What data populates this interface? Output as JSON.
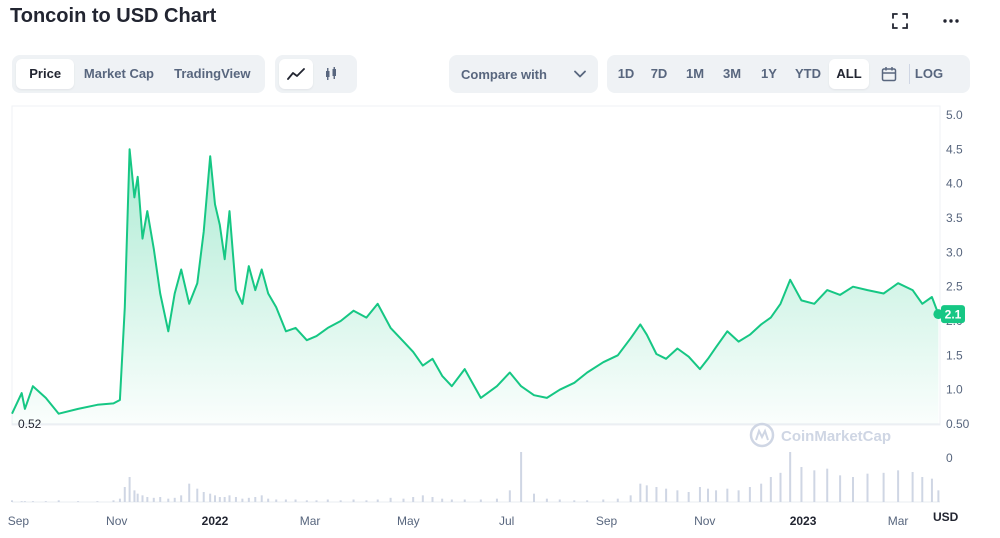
{
  "title": "Toncoin to USD Chart",
  "view_tabs": [
    {
      "label": "Price",
      "active": true
    },
    {
      "label": "Market Cap",
      "active": false
    },
    {
      "label": "TradingView",
      "active": false
    }
  ],
  "chart_type_icons": [
    "line-chart-icon",
    "candlestick-icon"
  ],
  "compare_label": "Compare with",
  "ranges": [
    "1D",
    "7D",
    "1M",
    "3M",
    "1Y",
    "YTD",
    "ALL"
  ],
  "active_range": "ALL",
  "log_label": "LOG",
  "watermark": "CoinMarketCap",
  "colors": {
    "line": "#16c784",
    "fill_top": "#16c784",
    "accent": "#16c784",
    "axis_text": "#58667e",
    "grid": "#eff2f5"
  },
  "chart_data": {
    "type": "area",
    "y_ticks": [
      "5.0",
      "4.5",
      "4.0",
      "3.5",
      "3.0",
      "2.5",
      "2.0",
      "1.5",
      "1.0",
      "0.50"
    ],
    "ylim": [
      0.5,
      5.0
    ],
    "volume_tick": "0",
    "x_ticks": [
      "Sep",
      "Nov",
      "2022",
      "Mar",
      "May",
      "Jul",
      "Sep",
      "Nov",
      "2023",
      "Mar"
    ],
    "x_tick_bold": [
      "2022",
      "2023"
    ],
    "currency_label": "USD",
    "start_label": "0.52",
    "current_value_label": "2.1",
    "x": [
      "2021-08-28",
      "2021-09-03",
      "2021-09-05",
      "2021-09-10",
      "2021-09-18",
      "2021-09-26",
      "2021-10-08",
      "2021-10-20",
      "2021-10-30",
      "2021-11-03",
      "2021-11-06",
      "2021-11-09",
      "2021-11-12",
      "2021-11-14",
      "2021-11-17",
      "2021-11-20",
      "2021-11-24",
      "2021-11-28",
      "2021-12-03",
      "2021-12-07",
      "2021-12-11",
      "2021-12-16",
      "2021-12-21",
      "2021-12-25",
      "2021-12-29",
      "2022-01-01",
      "2022-01-04",
      "2022-01-07",
      "2022-01-10",
      "2022-01-14",
      "2022-01-18",
      "2022-01-22",
      "2022-01-26",
      "2022-01-30",
      "2022-02-03",
      "2022-02-08",
      "2022-02-14",
      "2022-02-20",
      "2022-02-27",
      "2022-03-05",
      "2022-03-12",
      "2022-03-20",
      "2022-03-28",
      "2022-04-05",
      "2022-04-12",
      "2022-04-20",
      "2022-04-28",
      "2022-05-04",
      "2022-05-10",
      "2022-05-16",
      "2022-05-22",
      "2022-05-28",
      "2022-06-05",
      "2022-06-15",
      "2022-06-25",
      "2022-07-03",
      "2022-07-10",
      "2022-07-18",
      "2022-07-26",
      "2022-08-03",
      "2022-08-12",
      "2022-08-20",
      "2022-08-30",
      "2022-09-08",
      "2022-09-16",
      "2022-09-22",
      "2022-09-26",
      "2022-10-02",
      "2022-10-08",
      "2022-10-15",
      "2022-10-22",
      "2022-10-29",
      "2022-11-03",
      "2022-11-08",
      "2022-11-15",
      "2022-11-22",
      "2022-11-29",
      "2022-12-06",
      "2022-12-12",
      "2022-12-18",
      "2022-12-24",
      "2022-12-31",
      "2023-01-08",
      "2023-01-16",
      "2023-01-24",
      "2023-02-01",
      "2023-02-10",
      "2023-02-20",
      "2023-03-01",
      "2023-03-10",
      "2023-03-16",
      "2023-03-22",
      "2023-03-26"
    ],
    "values": [
      0.65,
      0.95,
      0.72,
      1.05,
      0.88,
      0.65,
      0.72,
      0.78,
      0.8,
      0.85,
      2.2,
      4.5,
      3.8,
      4.1,
      3.2,
      3.6,
      3.05,
      2.4,
      1.85,
      2.4,
      2.75,
      2.25,
      2.55,
      3.3,
      4.4,
      3.7,
      3.4,
      2.9,
      3.6,
      2.45,
      2.25,
      2.8,
      2.45,
      2.75,
      2.4,
      2.2,
      1.85,
      1.9,
      1.72,
      1.78,
      1.9,
      2.0,
      2.15,
      2.05,
      2.25,
      1.9,
      1.7,
      1.55,
      1.35,
      1.45,
      1.2,
      1.05,
      1.3,
      0.88,
      1.05,
      1.25,
      1.05,
      0.92,
      0.88,
      1.0,
      1.1,
      1.25,
      1.4,
      1.5,
      1.75,
      1.95,
      1.8,
      1.52,
      1.45,
      1.6,
      1.48,
      1.3,
      1.45,
      1.62,
      1.85,
      1.7,
      1.8,
      1.95,
      2.05,
      2.25,
      2.6,
      2.3,
      2.25,
      2.45,
      2.38,
      2.5,
      2.45,
      2.4,
      2.55,
      2.45,
      2.25,
      2.35,
      2.1
    ],
    "volume": [
      2,
      1,
      1,
      1,
      1,
      2,
      1,
      1,
      2,
      4,
      18,
      30,
      14,
      10,
      8,
      6,
      5,
      6,
      4,
      5,
      8,
      22,
      16,
      12,
      10,
      8,
      6,
      6,
      8,
      6,
      4,
      5,
      6,
      8,
      4,
      3,
      3,
      3,
      2,
      2,
      3,
      2,
      3,
      2,
      3,
      5,
      4,
      6,
      8,
      6,
      4,
      3,
      3,
      3,
      4,
      14,
      60,
      10,
      4,
      3,
      2,
      2,
      3,
      4,
      8,
      22,
      20,
      18,
      16,
      14,
      12,
      18,
      16,
      14,
      16,
      14,
      18,
      22,
      30,
      35,
      60,
      42,
      38,
      40,
      32,
      30,
      34,
      35,
      38,
      36,
      30,
      28,
      14
    ]
  }
}
